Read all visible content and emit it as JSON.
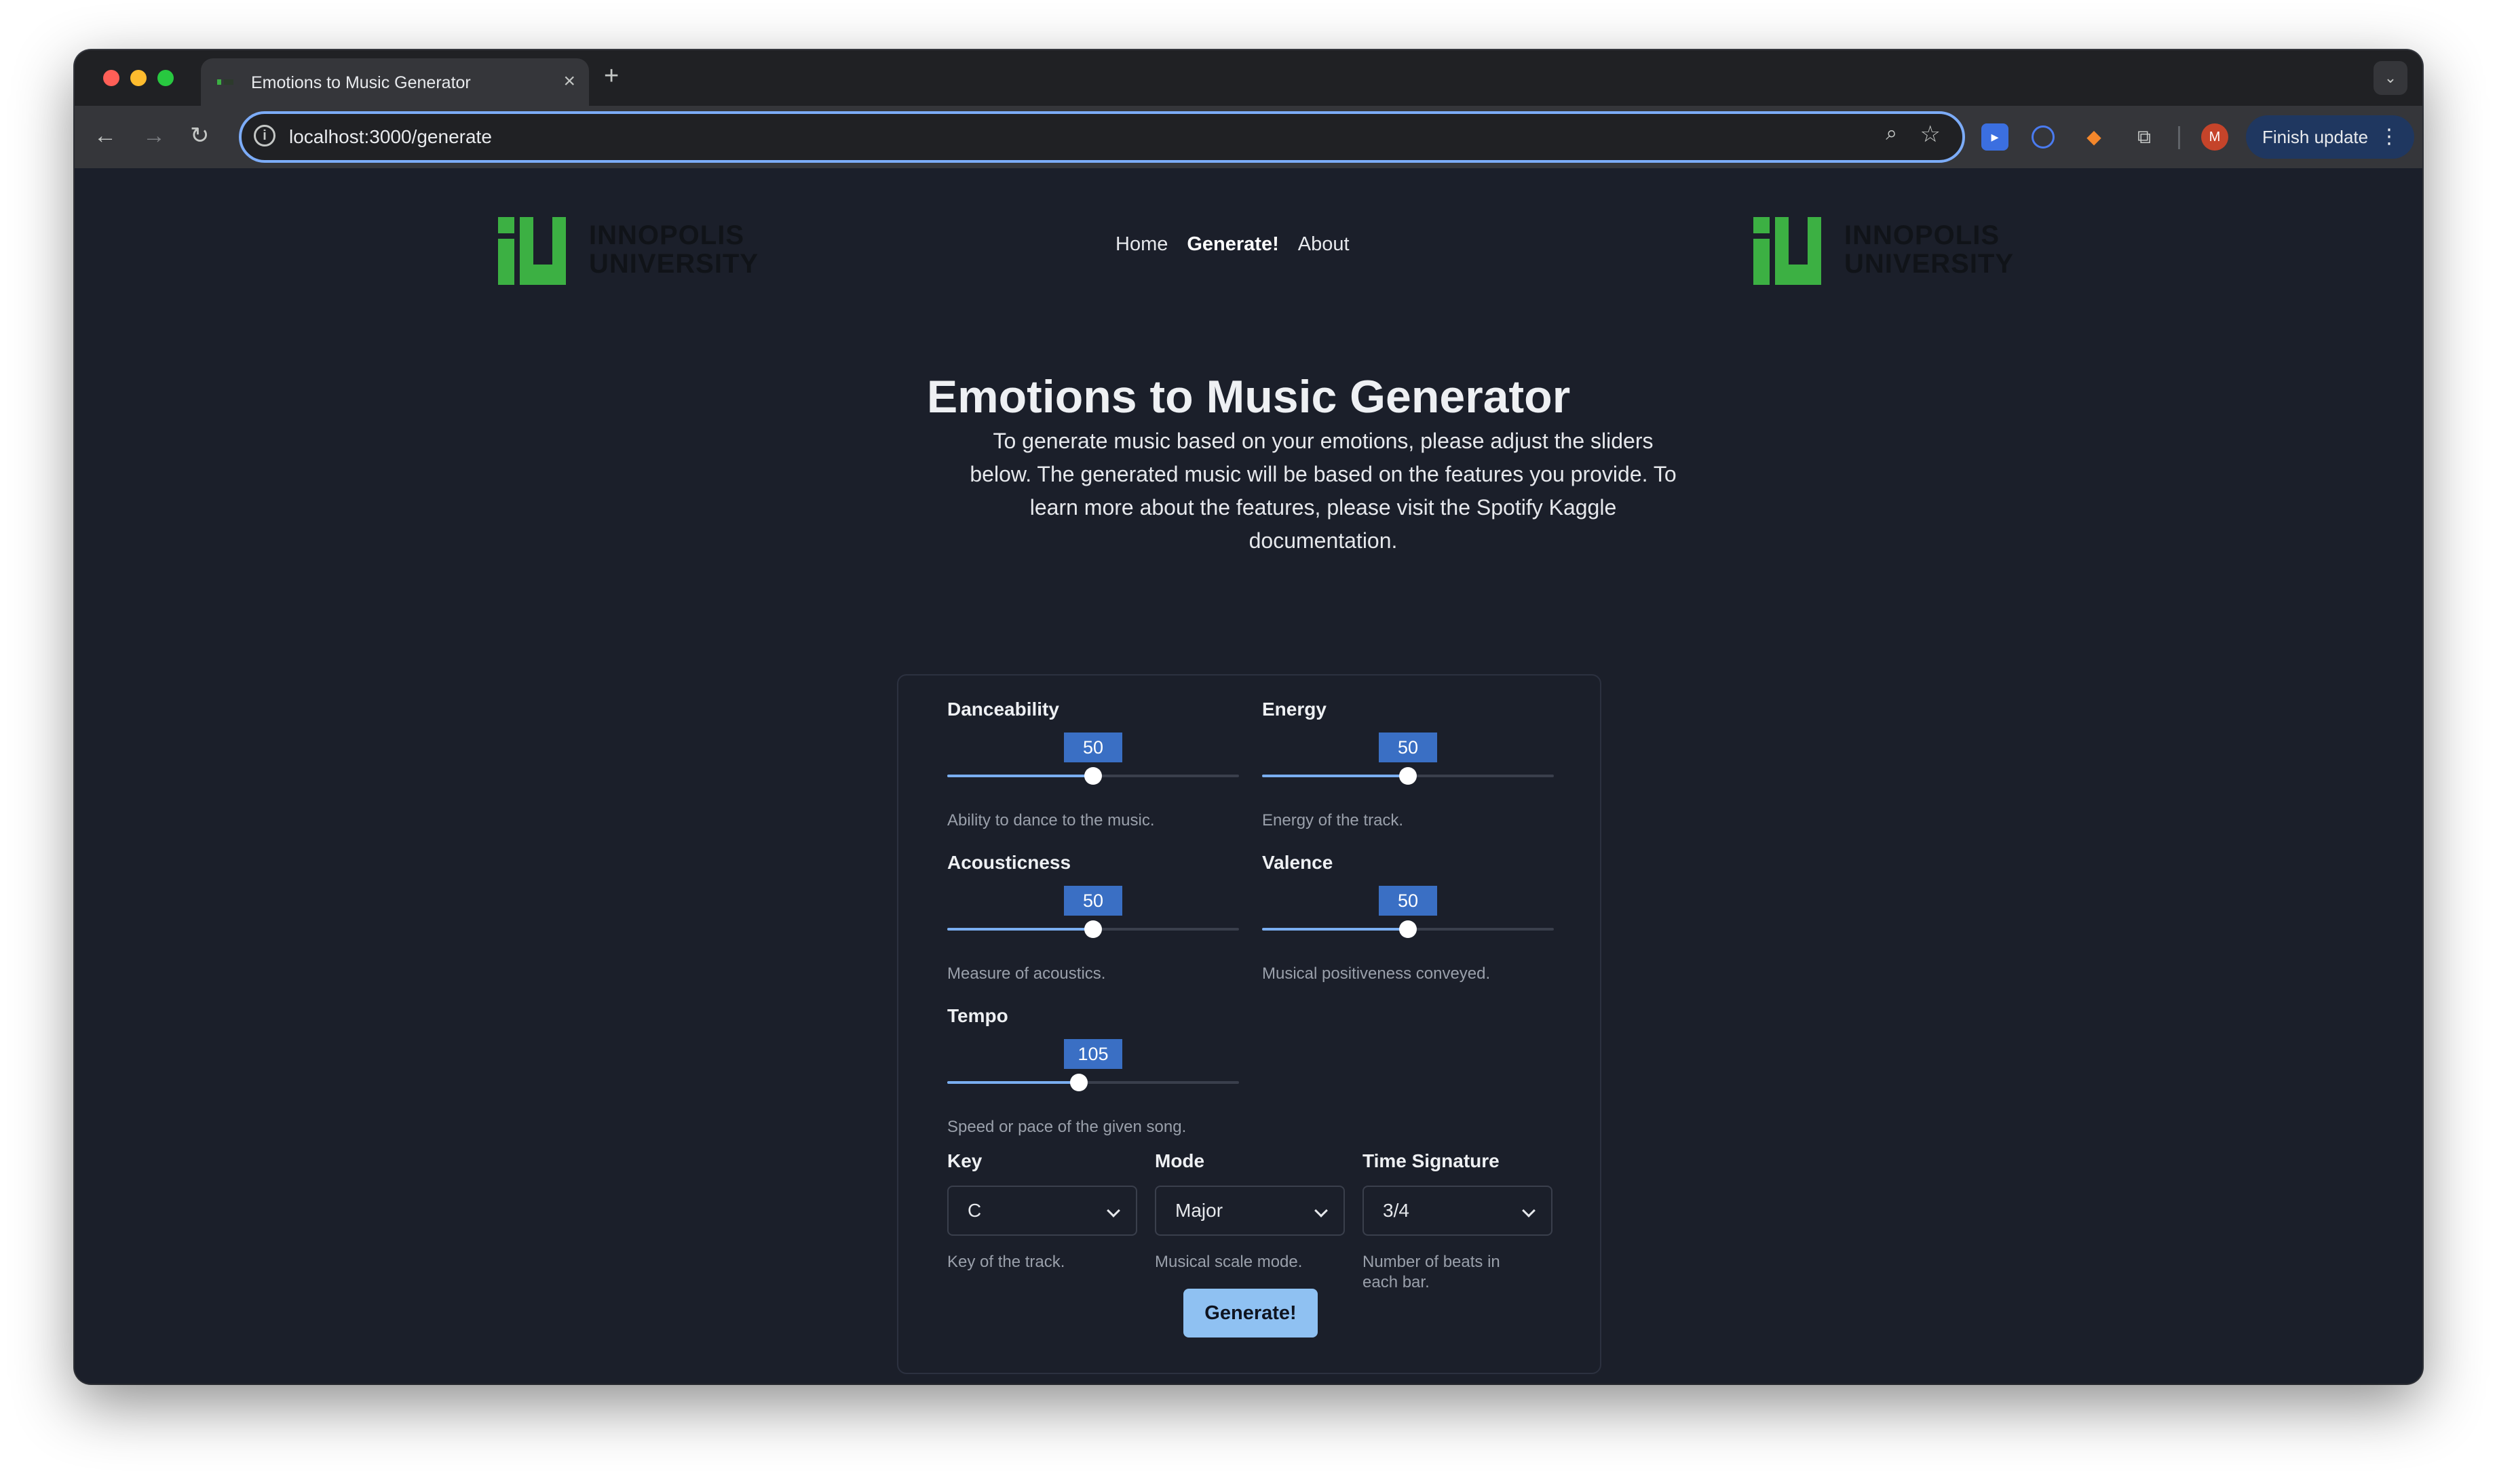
{
  "browser": {
    "tab_title": "Emotions to Music Generator",
    "tab_close_icon": "close-icon",
    "new_tab_label": "+",
    "url": "localhost:3000/generate",
    "finish_update_label": "Finish update",
    "avatar_initial": "M"
  },
  "header": {
    "logo_line1": "INNOPOLIS",
    "logo_line2": "UNIVERSITY",
    "logo_color": "#3cb043",
    "nav": {
      "home": "Home",
      "generate": "Generate!",
      "about": "About"
    }
  },
  "main": {
    "title": "Emotions to Music Generator",
    "intro": "To generate music based on your emotions, please adjust the sliders below. The generated music will be based on the features you provide. To learn more about the features, please visit the Spotify Kaggle documentation."
  },
  "sliders": {
    "danceability": {
      "label": "Danceability",
      "value": "50",
      "fraction": 0.5,
      "help": "Ability to dance to the music."
    },
    "energy": {
      "label": "Energy",
      "value": "50",
      "fraction": 0.5,
      "help": "Energy of the track."
    },
    "acousticness": {
      "label": "Acousticness",
      "value": "50",
      "fraction": 0.5,
      "help": "Measure of acoustics."
    },
    "valence": {
      "label": "Valence",
      "value": "50",
      "fraction": 0.5,
      "help": "Musical positiveness conveyed."
    },
    "tempo": {
      "label": "Tempo",
      "value": "105",
      "fraction": 0.45,
      "help": "Speed or pace of the given song."
    }
  },
  "selects": {
    "key": {
      "label": "Key",
      "value": "C",
      "help": "Key of the track."
    },
    "mode": {
      "label": "Mode",
      "value": "Major",
      "help": "Musical scale mode."
    },
    "time_signature": {
      "label": "Time Signature",
      "value": "3/4",
      "help": "Number of beats in each bar."
    }
  },
  "actions": {
    "generate_label": "Generate!"
  },
  "colors": {
    "accent": "#3a6fc4",
    "button": "#8fc1f2",
    "background": "#1b1f2a"
  }
}
